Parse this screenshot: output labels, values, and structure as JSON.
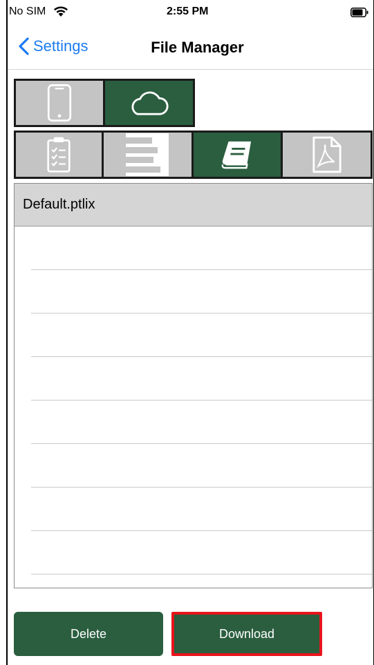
{
  "status_bar": {
    "carrier": "No SIM",
    "time": "2:55 PM",
    "wifi_icon": "wifi-icon",
    "battery_icon": "battery-icon"
  },
  "nav": {
    "back_label": "Settings",
    "title": "File Manager"
  },
  "storage_tabs": [
    {
      "icon": "phone-icon",
      "selected": false
    },
    {
      "icon": "cloud-icon",
      "selected": true
    }
  ],
  "type_tabs": [
    {
      "icon": "checklist-clipboard-icon",
      "selected": false
    },
    {
      "icon": "bar-list-icon",
      "selected": false
    },
    {
      "icon": "book-icon",
      "selected": true
    },
    {
      "icon": "pdf-icon",
      "selected": false
    }
  ],
  "file_list": {
    "header": "Default.ptlix",
    "rows": [
      "",
      "",
      "",
      "",
      "",
      "",
      "",
      "",
      ""
    ]
  },
  "actions": {
    "delete_label": "Delete",
    "download_label": "Download"
  },
  "colors": {
    "accent_green": "#2a5e3f",
    "inactive_gray": "#c4c4c4",
    "ios_blue": "#1b7bf0",
    "highlight_red": "#e8141c"
  }
}
